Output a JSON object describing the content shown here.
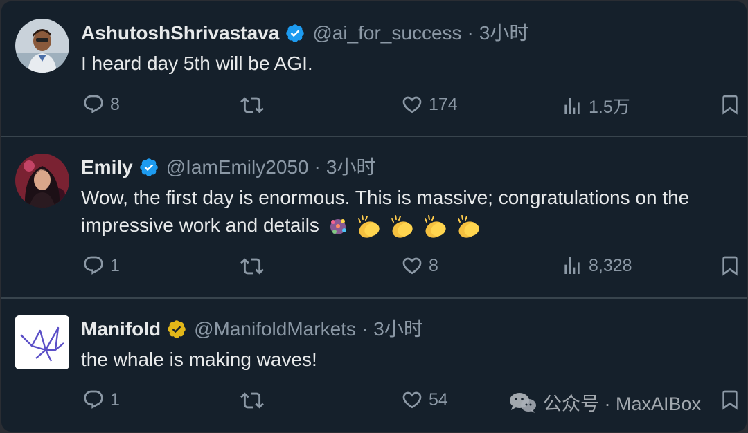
{
  "tweets": [
    {
      "name": "AshutoshShrivastava",
      "verified": "blue",
      "handle": "@ai_for_success",
      "time": "3小时",
      "text": "I heard day 5th will be AGI.",
      "replies": "8",
      "retweets": "",
      "likes": "174",
      "views": "1.5万"
    },
    {
      "name": "Emily",
      "verified": "blue",
      "handle": "@IamEmily2050",
      "time": "3小时",
      "text": "Wow, the first day is enormous. This is massive; congratulations on the impressive work and details",
      "text_line1": "Wow, the first day is enormous. This is massive; congratulations on the",
      "text_line2": "impressive work and details",
      "emojis": [
        "confetti-emoji",
        "clapping-hands-emoji",
        "clapping-hands-emoji",
        "clapping-hands-emoji",
        "clapping-hands-emoji"
      ],
      "replies": "1",
      "retweets": "",
      "likes": "8",
      "views": "8,328"
    },
    {
      "name": "Manifold",
      "verified": "gold",
      "handle": "@ManifoldMarkets",
      "time": "3小时",
      "text": "the whale is making waves!",
      "replies": "1",
      "retweets": "",
      "likes": "54",
      "views": ""
    }
  ],
  "watermark": {
    "label": "公众号 · MaxAIBox"
  },
  "colors": {
    "background": "#15202b",
    "text": "#e7e9ea",
    "muted": "#8b98a5",
    "divider": "#38444d",
    "verified_blue": "#1d9bf0",
    "verified_gold": "#e2b719"
  }
}
